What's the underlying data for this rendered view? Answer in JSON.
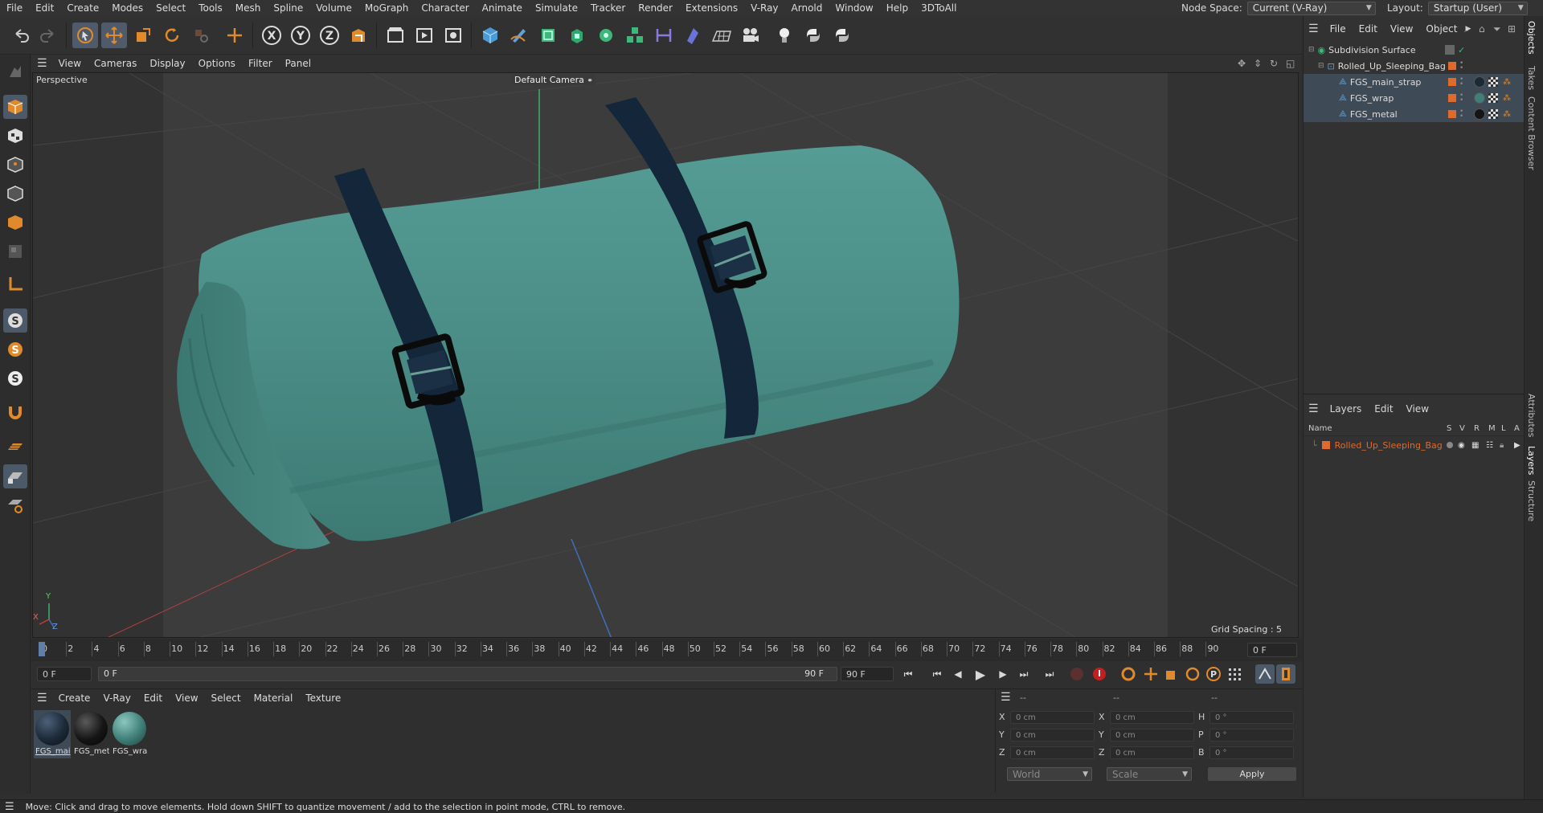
{
  "menubar": {
    "items": [
      "File",
      "Edit",
      "Create",
      "Modes",
      "Select",
      "Tools",
      "Mesh",
      "Spline",
      "Volume",
      "MoGraph",
      "Character",
      "Animate",
      "Simulate",
      "Tracker",
      "Render",
      "Extensions",
      "V-Ray",
      "Arnold",
      "Window",
      "Help",
      "3DToAll"
    ],
    "node_space_label": "Node Space:",
    "node_space_value": "Current (V-Ray)",
    "layout_label": "Layout:",
    "layout_value": "Startup (User)"
  },
  "viewport": {
    "menu": [
      "View",
      "Cameras",
      "Display",
      "Options",
      "Filter",
      "Panel"
    ],
    "view_name": "Perspective",
    "camera_name": "Default Camera",
    "grid_spacing": "Grid Spacing : 5 cm",
    "axis_x": "X",
    "axis_y": "Y",
    "axis_z": "Z"
  },
  "timeline": {
    "ticks": [
      "0",
      "2",
      "4",
      "6",
      "8",
      "10",
      "12",
      "14",
      "16",
      "18",
      "20",
      "22",
      "24",
      "26",
      "28",
      "30",
      "32",
      "34",
      "36",
      "38",
      "40",
      "42",
      "44",
      "46",
      "48",
      "50",
      "52",
      "54",
      "56",
      "58",
      "60",
      "62",
      "64",
      "66",
      "68",
      "70",
      "72",
      "74",
      "76",
      "78",
      "80",
      "82",
      "84",
      "86",
      "88",
      "90"
    ],
    "current_frame": "0 F",
    "start_field": "0 F",
    "range_start": "0 F",
    "range_end": "90 F",
    "end_field": "90 F"
  },
  "materials": {
    "menu": [
      "Create",
      "V-Ray",
      "Edit",
      "View",
      "Select",
      "Material",
      "Texture"
    ],
    "items": [
      {
        "name": "FGS_mai",
        "color": "#1c2a38"
      },
      {
        "name": "FGS_met",
        "color": "#151515"
      },
      {
        "name": "FGS_wra",
        "color": "#3f7f78"
      }
    ]
  },
  "coords": {
    "header": [
      "--",
      "--",
      "--"
    ],
    "rows": [
      {
        "a": "X",
        "av": "0 cm",
        "b": "X",
        "bv": "0 cm",
        "c": "H",
        "cv": "0 °"
      },
      {
        "a": "Y",
        "av": "0 cm",
        "b": "Y",
        "bv": "0 cm",
        "c": "P",
        "cv": "0 °"
      },
      {
        "a": "Z",
        "av": "0 cm",
        "b": "Z",
        "bv": "0 cm",
        "c": "B",
        "cv": "0 °"
      }
    ],
    "world": "World",
    "scale": "Scale",
    "apply": "Apply"
  },
  "objects": {
    "menu": [
      "File",
      "Edit",
      "View",
      "Object"
    ],
    "tree": [
      {
        "name": "Subdivision Surface"
      },
      {
        "name": "Rolled_Up_Sleeping_Bag"
      },
      {
        "name": "FGS_main_strap"
      },
      {
        "name": "FGS_wrap"
      },
      {
        "name": "FGS_metal"
      }
    ]
  },
  "layers": {
    "menu": [
      "Layers",
      "Edit",
      "View"
    ],
    "columns": {
      "name": "Name",
      "s": "S",
      "v": "V",
      "r": "R",
      "m": "M",
      "l": "L",
      "a": "A"
    },
    "items": [
      {
        "name": "Rolled_Up_Sleeping_Bag"
      }
    ]
  },
  "side_tabs": [
    "Objects",
    "Takes",
    "Content Browser",
    "Attributes",
    "Layers",
    "Structure"
  ],
  "status": "Move: Click and drag to move elements. Hold down SHIFT to quantize movement / add to the selection in point mode, CTRL to remove.",
  "colors": {
    "accent": "#e06a2b",
    "bag": "#4a8f88",
    "strap": "#13263a",
    "selection": "#3f4a57"
  }
}
